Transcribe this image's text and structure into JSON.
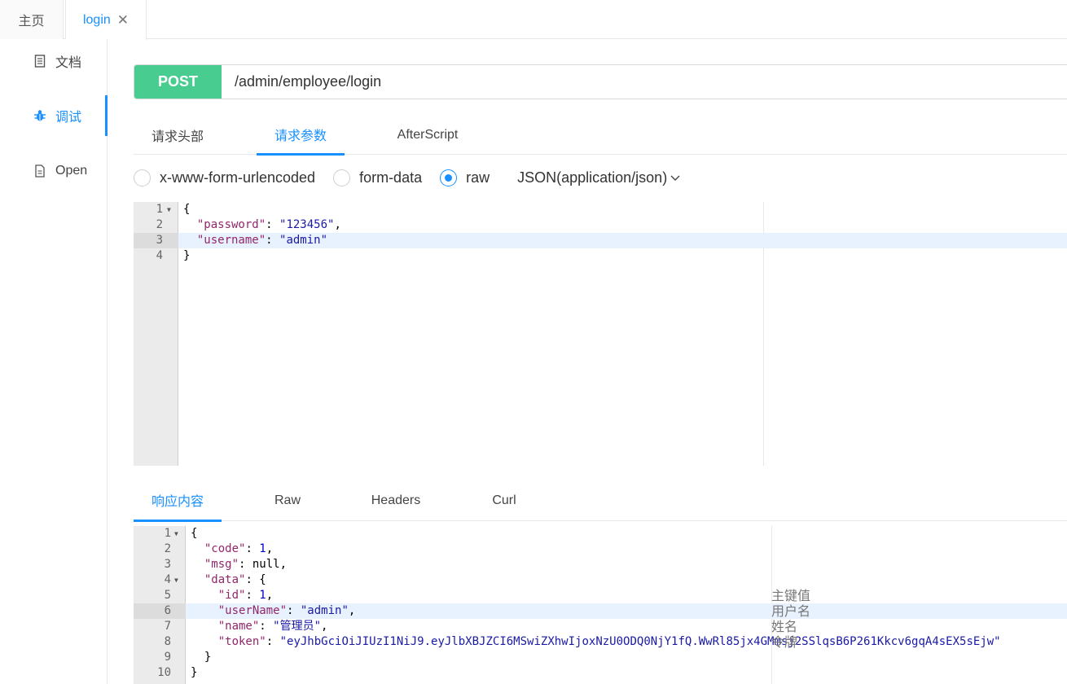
{
  "top_tabs": [
    {
      "label": "主页"
    },
    {
      "label": "login",
      "close": "✕"
    }
  ],
  "sidenav": [
    {
      "label": "文档",
      "icon": "document-icon"
    },
    {
      "label": "调试",
      "icon": "bug-icon"
    },
    {
      "label": "Open",
      "icon": "file-icon"
    }
  ],
  "request": {
    "method": "POST",
    "url": "/admin/employee/login",
    "method_color": "#49cc90"
  },
  "param_tabs": [
    "请求头部",
    "请求参数",
    "AfterScript"
  ],
  "body_types": [
    "x-www-form-urlencoded",
    "form-data",
    "raw"
  ],
  "selected_body_type": "raw",
  "content_type": "JSON(application/json)",
  "request_body": {
    "line_numbers": [
      "1",
      "2",
      "3",
      "4"
    ],
    "lines": [
      "{",
      "\"password\"",
      ": ",
      "\"123456\"",
      ",",
      "\"username\"",
      ": ",
      "\"admin\"",
      "}"
    ]
  },
  "response_tabs": [
    "响应内容",
    "Raw",
    "Headers",
    "Curl"
  ],
  "response_body": {
    "line_numbers": [
      "1",
      "2",
      "3",
      "4",
      "5",
      "6",
      "7",
      "8",
      "9",
      "10"
    ],
    "keys": {
      "code": "\"code\"",
      "msg": "\"msg\"",
      "data": "\"data\"",
      "id": "\"id\"",
      "userName": "\"userName\"",
      "name": "\"name\"",
      "token": "\"token\""
    },
    "values": {
      "code": "1",
      "msg": "null",
      "id": "1",
      "userName": "\"admin\"",
      "name": "\"管理员\"",
      "token": "\"eyJhbGciOiJIUzI1NiJ9.eyJlbXBJZCI6MSwiZXhwIjoxNzU0ODQ0NjY1fQ.WwRl85jx4GMmsj2SSlqsB6P261Kkcv6gqA4sEX5sEjw\""
    }
  },
  "annotations": [
    "主键值",
    "用户名",
    "姓名",
    "令牌"
  ],
  "accent_color": "#1890ff"
}
